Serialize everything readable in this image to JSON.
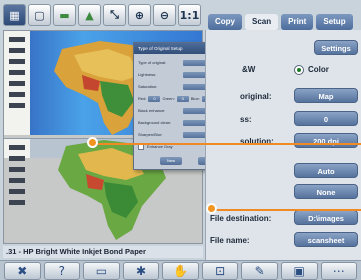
{
  "toolbar": {
    "buttons": [
      {
        "name": "select-icon",
        "glyph": "▦"
      },
      {
        "name": "single-page-icon",
        "glyph": "▢"
      },
      {
        "name": "image-preview-icon",
        "glyph": "▬"
      },
      {
        "name": "landscape-icon",
        "glyph": "▲"
      },
      {
        "name": "zoom-region-icon",
        "glyph": "⤡"
      },
      {
        "name": "zoom-in-icon",
        "glyph": "⊕"
      },
      {
        "name": "zoom-out-icon",
        "glyph": "⊖"
      },
      {
        "name": "actual-size-icon",
        "glyph": "1:1"
      }
    ]
  },
  "dialog": {
    "title": "Type of Original Setup",
    "rows": {
      "type_label": "Type of original:",
      "type_value": "Real",
      "lightness_label": "Lightness:",
      "lightness_value": "11",
      "saturation_label": "Saturation:",
      "saturation_value": "0",
      "red_label": "Red:",
      "red_value": "0",
      "green_label": "Green:",
      "green_value": "0",
      "blue_label": "Blue:",
      "blue_value": "0",
      "black_label": "Black enhance:",
      "black_value": "76",
      "bg_label": "Background clean:",
      "bg_value": "2",
      "blur_label": "Sharpen/Blur:",
      "blur_value": "2",
      "enhance_label": "Enhance Gray",
      "new_label": "New",
      "ok_label": "OK"
    }
  },
  "paper_label": ".31 - HP Bright White Inkjet Bond Paper",
  "tabs": [
    "Copy",
    "Scan",
    "Print",
    "Setup"
  ],
  "active_tab": "Scan",
  "panel": {
    "settings_label": "Settings",
    "bw_label": "&W",
    "color_label": "Color",
    "original_label": "original:",
    "original_value": "Map",
    "ss_label": "ss:",
    "ss_value": "0",
    "resolution_label": "solution:",
    "resolution_value": "200 dpi",
    "auto_label": "Auto",
    "none_label": "None",
    "file_destination_label": "File destination:",
    "file_destination_value": "D:\\images",
    "file_name_label": "File name:",
    "file_name_value": "scansheet"
  },
  "bottom_toolbar": [
    {
      "name": "delete-icon",
      "glyph": "✖"
    },
    {
      "name": "help-icon",
      "glyph": "?"
    },
    {
      "name": "folder-icon",
      "glyph": "▭"
    },
    {
      "name": "tools-icon",
      "glyph": "✱"
    },
    {
      "name": "scan-hand-icon",
      "glyph": "✋"
    },
    {
      "name": "preview-icon",
      "glyph": "⊡"
    },
    {
      "name": "edit-icon",
      "glyph": "✎"
    },
    {
      "name": "save-icon",
      "glyph": "▣"
    },
    {
      "name": "more-icon",
      "glyph": "⋯"
    }
  ],
  "colors": {
    "accent": "#4d6d9b",
    "callout": "#f08a24",
    "radio_on": "#1f7a27",
    "close": "#d9512c"
  }
}
